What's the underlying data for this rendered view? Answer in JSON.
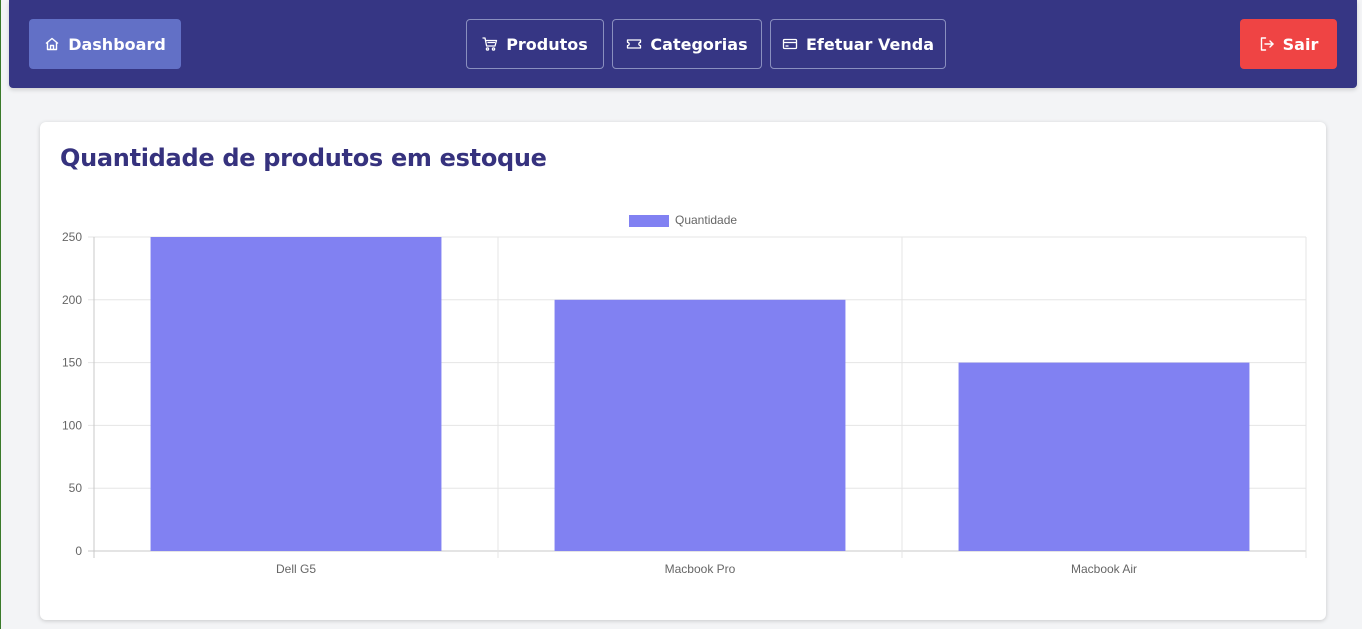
{
  "navbar": {
    "dashboard_label": "Dashboard",
    "produtos_label": "Produtos",
    "categorias_label": "Categorias",
    "venda_label": "Efetuar Venda",
    "sair_label": "Sair"
  },
  "colors": {
    "navbar_bg": "#363684",
    "dashboard_active": "#6270c6",
    "logout": "#ef4444",
    "bar": "#8181f2",
    "title": "#36327e"
  },
  "icons": {
    "dashboard": "home-icon",
    "produtos": "shopping-cart-icon",
    "categorias": "ticket-icon",
    "venda": "credit-card-icon",
    "sair": "logout-icon"
  },
  "card": {
    "title": "Quantidade de produtos em estoque"
  },
  "chart_data": {
    "type": "bar",
    "categories": [
      "Dell G5",
      "Macbook Pro",
      "Macbook Air"
    ],
    "series": [
      {
        "name": "Quantidade",
        "values": [
          250,
          200,
          150
        ]
      }
    ],
    "ylim": [
      0,
      250
    ],
    "yticks": [
      "0",
      "50",
      "100",
      "150",
      "200",
      "250"
    ],
    "legend_position": "top-center",
    "grid": true,
    "bar_color": "#8181f2"
  }
}
